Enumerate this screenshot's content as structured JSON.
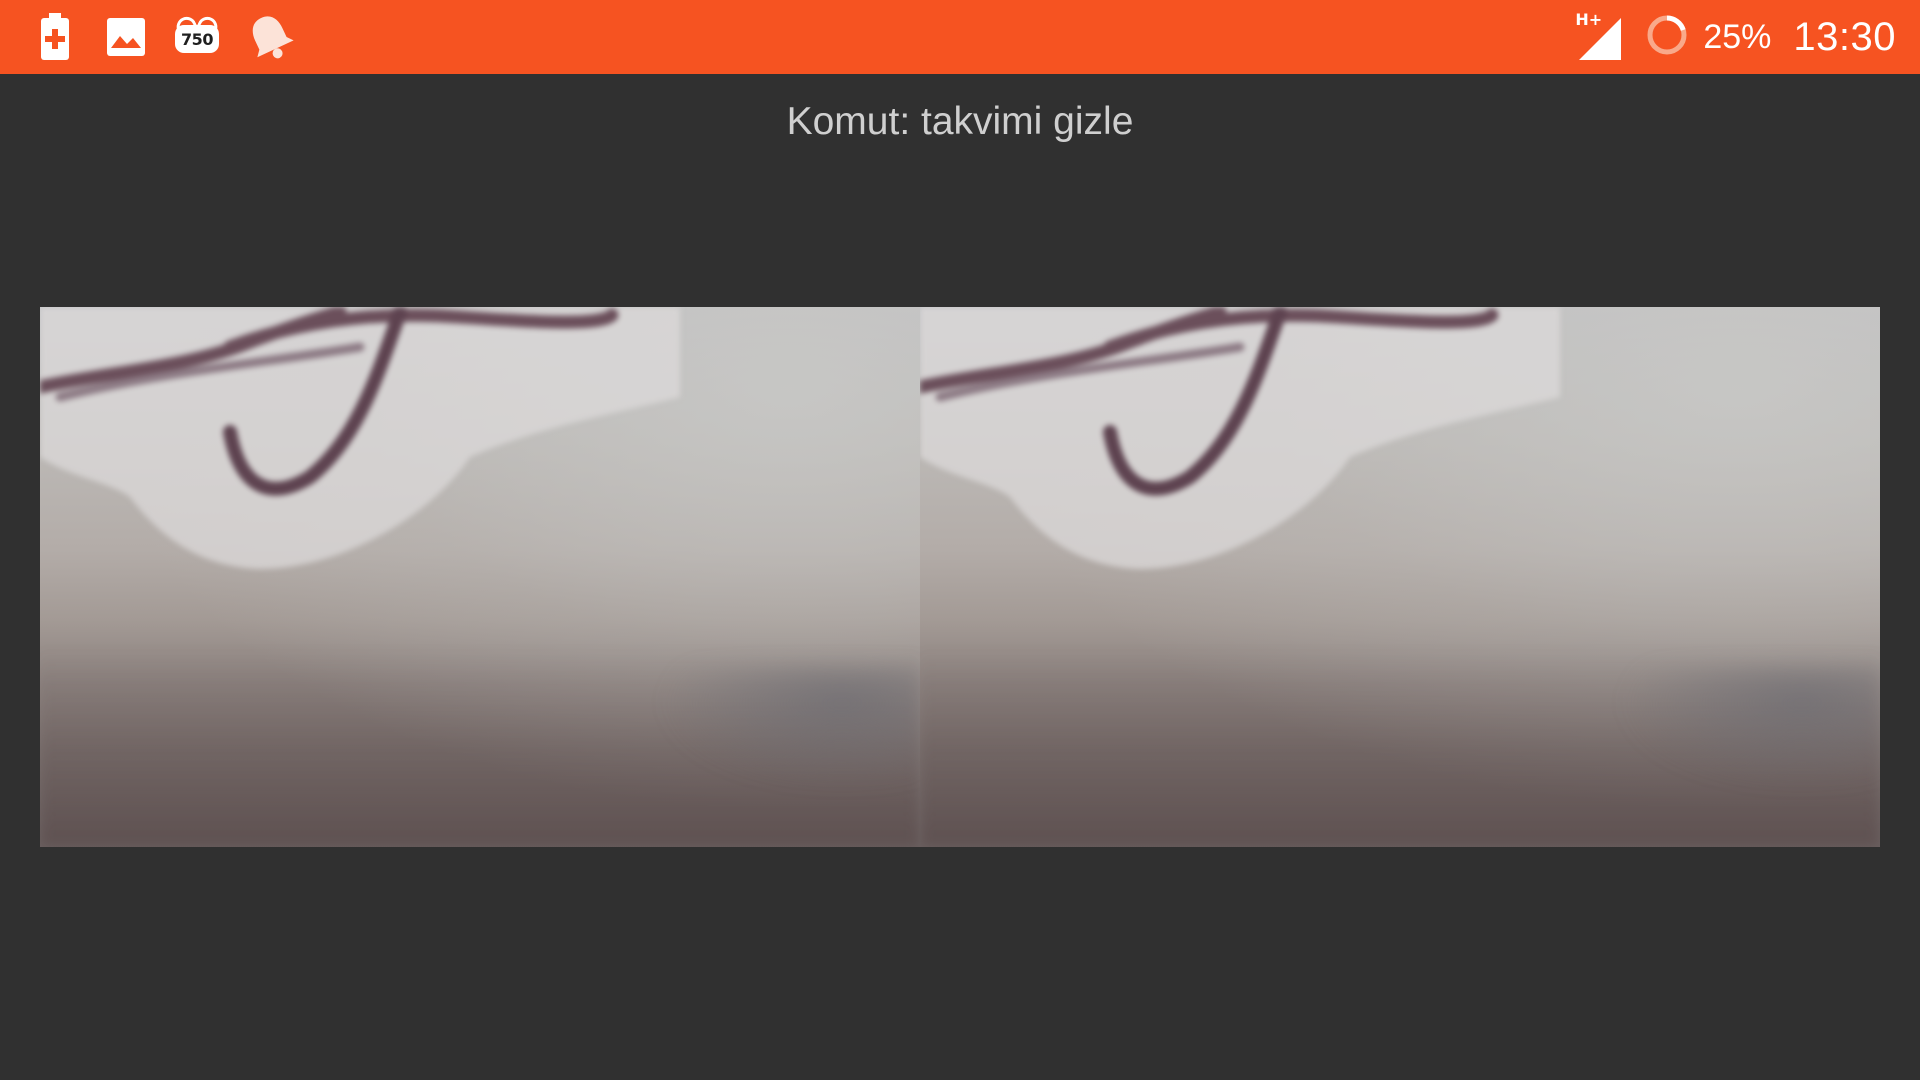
{
  "status_bar": {
    "background_color": "#F65321",
    "notification_icons": [
      {
        "icon": "battery-charging-plus-icon"
      },
      {
        "icon": "image-gallery-icon"
      },
      {
        "icon": "counter-badge-icon",
        "label": "750"
      },
      {
        "icon": "notification-bell-icon"
      }
    ],
    "network_type": "H+",
    "signal_icon": "cellular-signal-icon",
    "battery_ring_icon": "battery-ring-icon",
    "battery_percent": "25%",
    "clock": "13:30"
  },
  "command": {
    "text": "Komut: takvimi gizle"
  },
  "stereo_view": {
    "left_eye": "camera-preview-left",
    "right_eye": "camera-preview-right"
  }
}
